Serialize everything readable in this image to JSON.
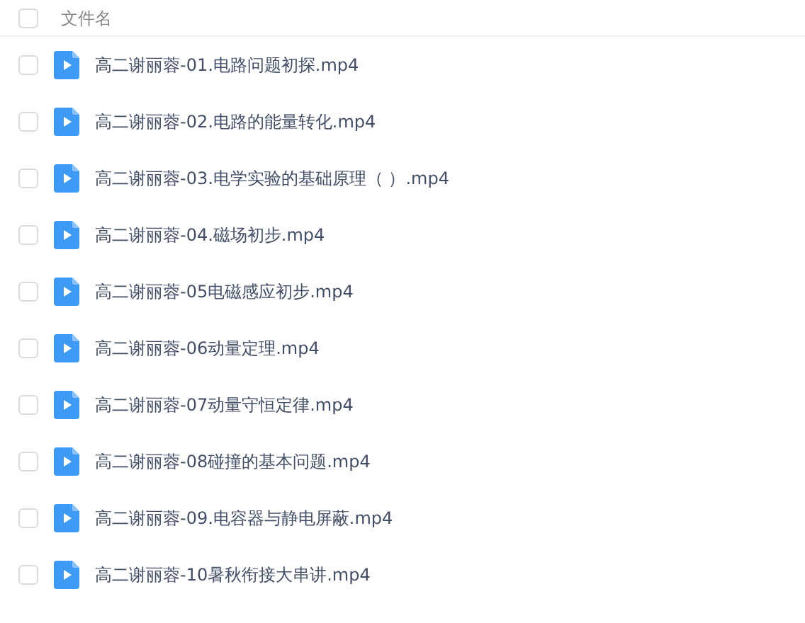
{
  "header": {
    "checked": false,
    "column_1": "文件名"
  },
  "files": [
    {
      "name": "高二谢丽蓉-01.电路问题初探.mp4",
      "checked": false
    },
    {
      "name": "高二谢丽蓉-02.电路的能量转化.mp4",
      "checked": false
    },
    {
      "name": "高二谢丽蓉-03.电学实验的基础原理（ ）.mp4",
      "checked": false
    },
    {
      "name": "高二谢丽蓉-04.磁场初步.mp4",
      "checked": false
    },
    {
      "name": "高二谢丽蓉-05电磁感应初步.mp4",
      "checked": false
    },
    {
      "name": "高二谢丽蓉-06动量定理.mp4",
      "checked": false
    },
    {
      "name": "高二谢丽蓉-07动量守恒定律.mp4",
      "checked": false
    },
    {
      "name": "高二谢丽蓉-08碰撞的基本问题.mp4",
      "checked": false
    },
    {
      "name": "高二谢丽蓉-09.电容器与静电屏蔽.mp4",
      "checked": false
    },
    {
      "name": "高二谢丽蓉-10暑秋衔接大串讲.mp4",
      "checked": false
    }
  ]
}
